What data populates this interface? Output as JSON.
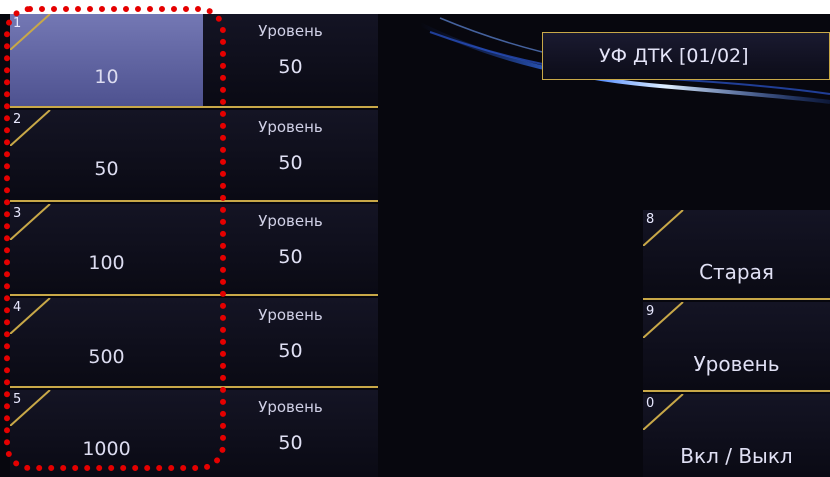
{
  "header": {
    "title": "УФ ДТК [01/02]"
  },
  "left_buttons": [
    {
      "index": "1",
      "value": "10",
      "level_label": "Уровень",
      "level_value": "50",
      "selected": true
    },
    {
      "index": "2",
      "value": "50",
      "level_label": "Уровень",
      "level_value": "50",
      "selected": false
    },
    {
      "index": "3",
      "value": "100",
      "level_label": "Уровень",
      "level_value": "50",
      "selected": false
    },
    {
      "index": "4",
      "value": "500",
      "level_label": "Уровень",
      "level_value": "50",
      "selected": false
    },
    {
      "index": "5",
      "value": "1000",
      "level_label": "Уровень",
      "level_value": "50",
      "selected": false
    }
  ],
  "right_buttons": [
    {
      "index": "8",
      "label": "Старая"
    },
    {
      "index": "9",
      "label": "Уровень"
    },
    {
      "index": "0",
      "label": "Вкл / Выкл"
    }
  ],
  "colors": {
    "accent": "#c8a848",
    "selected": "#6a6ea8",
    "annotation": "#e50000"
  }
}
